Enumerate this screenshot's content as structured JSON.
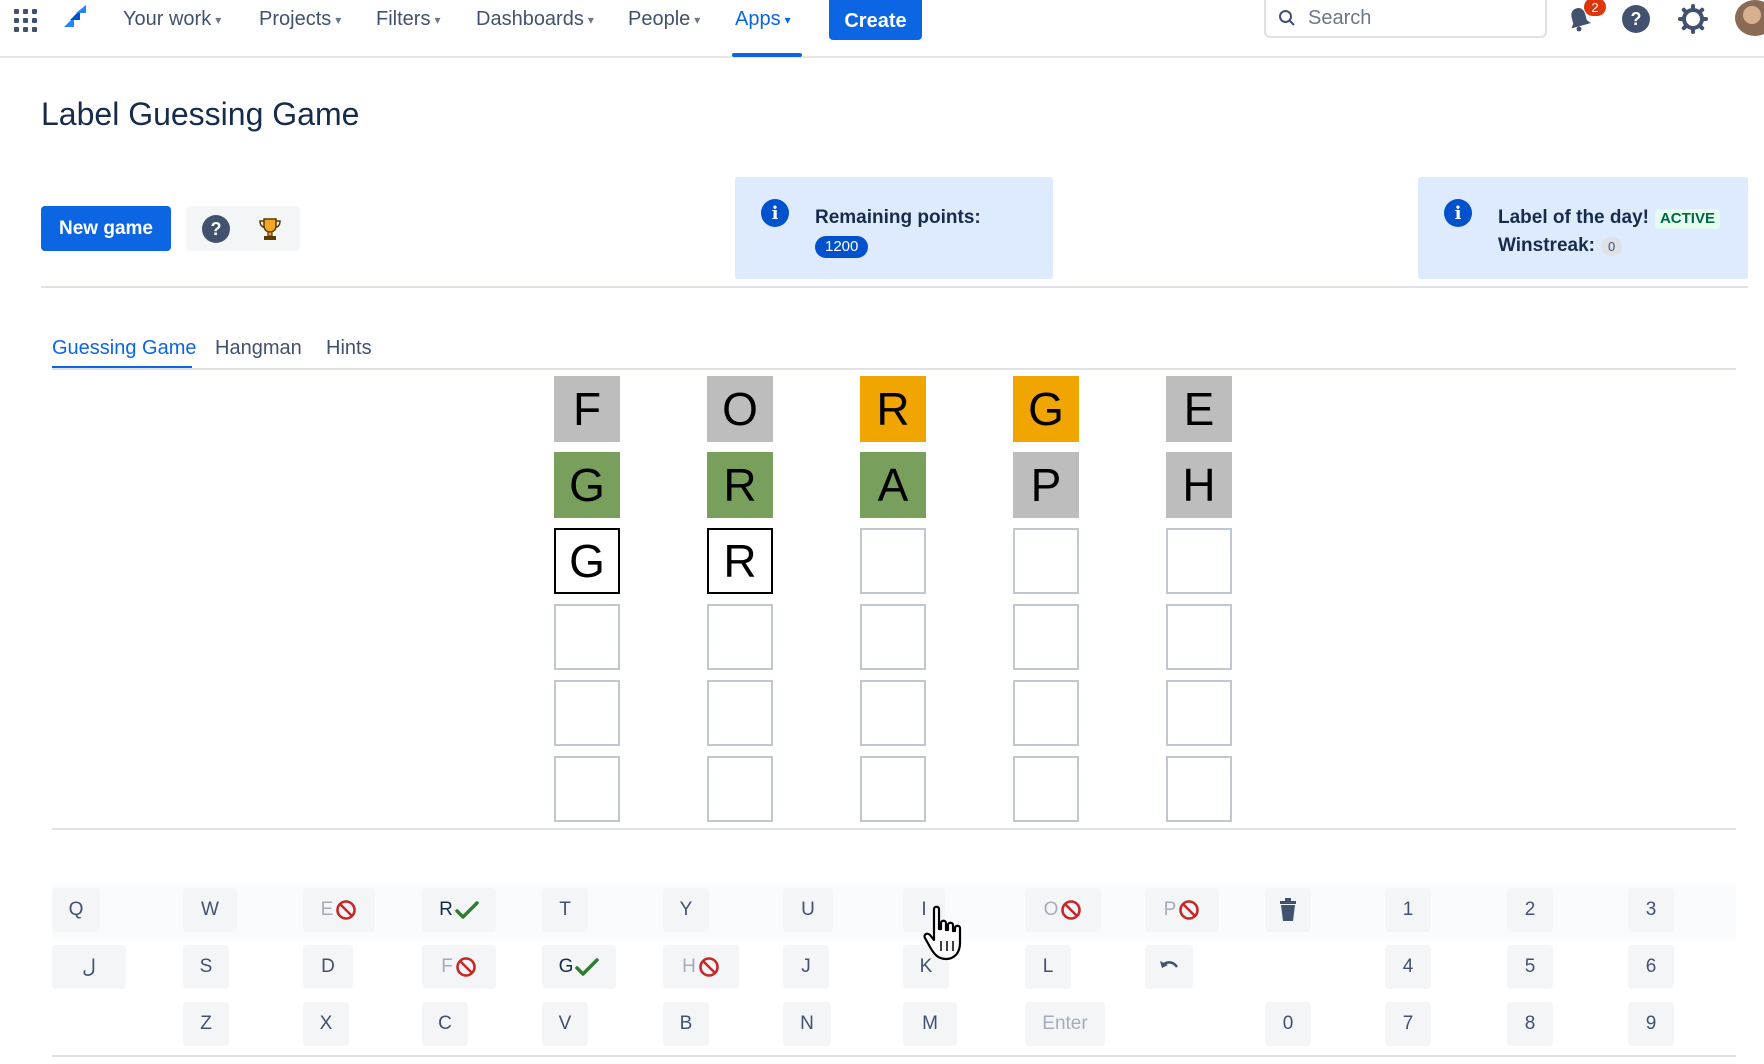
{
  "nav": {
    "items": [
      {
        "label": "Your work"
      },
      {
        "label": "Projects"
      },
      {
        "label": "Filters"
      },
      {
        "label": "Dashboards"
      },
      {
        "label": "People"
      },
      {
        "label": "Apps"
      }
    ],
    "active": "Apps",
    "create_label": "Create",
    "search_placeholder": "Search",
    "notification_count": "2"
  },
  "page": {
    "title": "Label Guessing Game",
    "new_game_label": "New game",
    "remaining": {
      "label": "Remaining points:",
      "value": "1200"
    },
    "label_of_day": {
      "label": "Label of the day!",
      "status": "ACTIVE",
      "winstreak_label": "Winstreak:",
      "winstreak_value": "0"
    }
  },
  "tabs": [
    {
      "label": "Guessing Game",
      "active": true
    },
    {
      "label": "Hangman",
      "active": false
    },
    {
      "label": "Hints",
      "active": false
    }
  ],
  "board": {
    "rows": [
      [
        {
          "letter": "F",
          "state": "absent"
        },
        {
          "letter": "O",
          "state": "absent"
        },
        {
          "letter": "R",
          "state": "present"
        },
        {
          "letter": "G",
          "state": "present"
        },
        {
          "letter": "E",
          "state": "absent"
        }
      ],
      [
        {
          "letter": "G",
          "state": "correct"
        },
        {
          "letter": "R",
          "state": "correct"
        },
        {
          "letter": "A",
          "state": "correct"
        },
        {
          "letter": "P",
          "state": "absent"
        },
        {
          "letter": "H",
          "state": "absent"
        }
      ],
      [
        {
          "letter": "G",
          "state": "typed"
        },
        {
          "letter": "R",
          "state": "typed"
        },
        {
          "letter": "",
          "state": "empty"
        },
        {
          "letter": "",
          "state": "empty"
        },
        {
          "letter": "",
          "state": "empty"
        }
      ],
      [
        {
          "letter": "",
          "state": "empty"
        },
        {
          "letter": "",
          "state": "empty"
        },
        {
          "letter": "",
          "state": "empty"
        },
        {
          "letter": "",
          "state": "empty"
        },
        {
          "letter": "",
          "state": "empty"
        }
      ],
      [
        {
          "letter": "",
          "state": "empty"
        },
        {
          "letter": "",
          "state": "empty"
        },
        {
          "letter": "",
          "state": "empty"
        },
        {
          "letter": "",
          "state": "empty"
        },
        {
          "letter": "",
          "state": "empty"
        }
      ],
      [
        {
          "letter": "",
          "state": "empty"
        },
        {
          "letter": "",
          "state": "empty"
        },
        {
          "letter": "",
          "state": "empty"
        },
        {
          "letter": "",
          "state": "empty"
        },
        {
          "letter": "",
          "state": "empty"
        }
      ]
    ]
  },
  "keyboard": {
    "row1": [
      {
        "label": "Q",
        "mark": ""
      },
      {
        "label": "W",
        "mark": ""
      },
      {
        "label": "E",
        "mark": "no"
      },
      {
        "label": "R",
        "mark": "ok"
      },
      {
        "label": "T",
        "mark": ""
      },
      {
        "label": "Y",
        "mark": ""
      },
      {
        "label": "U",
        "mark": ""
      },
      {
        "label": "I",
        "mark": ""
      },
      {
        "label": "O",
        "mark": "no"
      },
      {
        "label": "P",
        "mark": "no"
      },
      {
        "label": "delete-icon",
        "mark": "icon"
      },
      {
        "label": "1",
        "mark": ""
      },
      {
        "label": "2",
        "mark": ""
      },
      {
        "label": "3",
        "mark": ""
      }
    ],
    "row2": [
      {
        "label": "ﻝ",
        "mark": ""
      },
      {
        "label": "S",
        "mark": ""
      },
      {
        "label": "D",
        "mark": ""
      },
      {
        "label": "F",
        "mark": "no"
      },
      {
        "label": "G",
        "mark": "ok"
      },
      {
        "label": "H",
        "mark": "no"
      },
      {
        "label": "J",
        "mark": ""
      },
      {
        "label": "K",
        "mark": ""
      },
      {
        "label": "L",
        "mark": ""
      },
      {
        "label": "undo-icon",
        "mark": "icon"
      },
      {
        "label": "4",
        "mark": ""
      },
      {
        "label": "5",
        "mark": ""
      },
      {
        "label": "6",
        "mark": ""
      }
    ],
    "row3": [
      {
        "label": "Z",
        "mark": ""
      },
      {
        "label": "X",
        "mark": ""
      },
      {
        "label": "C",
        "mark": ""
      },
      {
        "label": "V",
        "mark": ""
      },
      {
        "label": "B",
        "mark": ""
      },
      {
        "label": "N",
        "mark": ""
      },
      {
        "label": "M",
        "mark": ""
      },
      {
        "label": "Enter",
        "mark": ""
      },
      {
        "label": "0",
        "mark": ""
      },
      {
        "label": "7",
        "mark": ""
      },
      {
        "label": "8",
        "mark": ""
      },
      {
        "label": "9",
        "mark": ""
      }
    ]
  },
  "colors": {
    "accent": "#0c66e4",
    "absent": "#bdbdbd",
    "present": "#f0a500",
    "correct": "#78a05c",
    "info_bg": "#deebff"
  }
}
